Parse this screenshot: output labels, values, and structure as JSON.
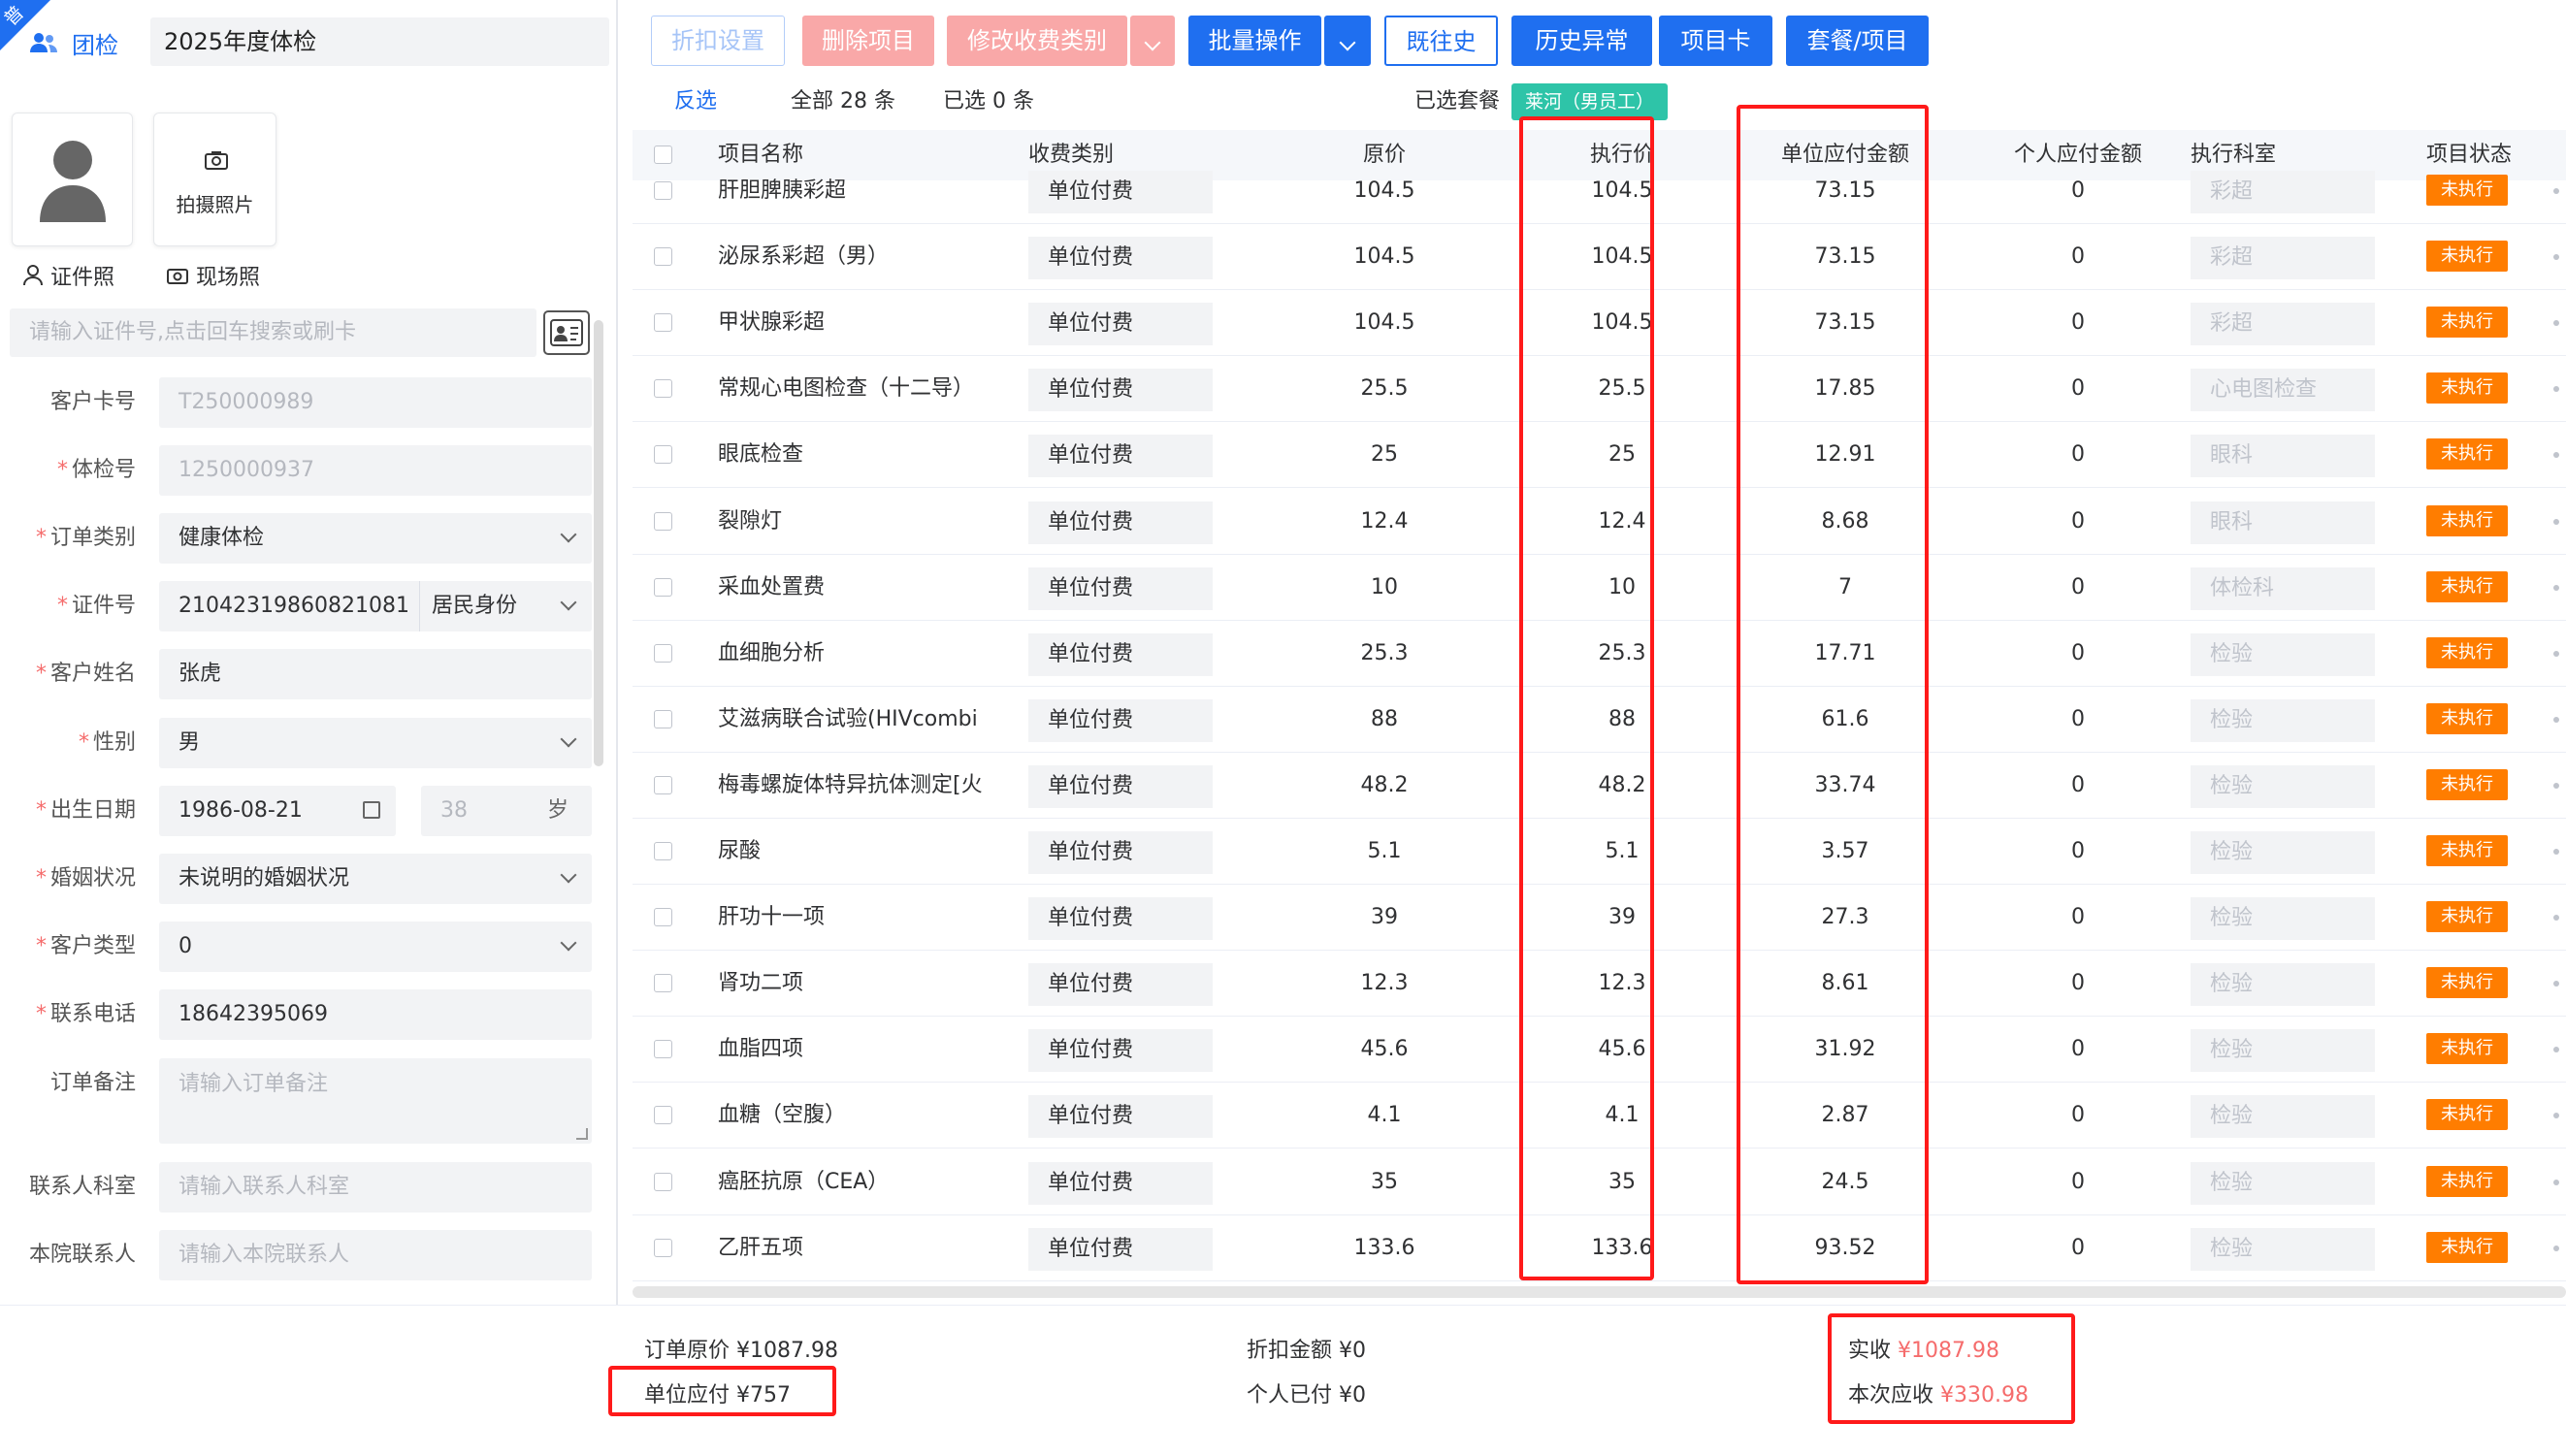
{
  "corner_badge": "普",
  "group_tab": "团检",
  "order_name": "2025年度体检",
  "photo": {
    "capture_label": "拍摄照片",
    "id_photo_label": "证件照",
    "live_photo_label": "现场照"
  },
  "search": {
    "placeholder": "请输入证件号,点击回车搜索或刷卡"
  },
  "form": [
    {
      "label": "客户卡号",
      "required": false,
      "value": "T250000989",
      "muted": true
    },
    {
      "label": "体检号",
      "required": true,
      "value": "1250000937",
      "muted": true
    },
    {
      "label": "订单类别",
      "required": true,
      "value": "健康体检",
      "select": true
    },
    {
      "label": "证件号",
      "required": true,
      "value": "21042319860821081",
      "id_type": "居民身份"
    },
    {
      "label": "客户姓名",
      "required": true,
      "value": "张虎"
    },
    {
      "label": "性别",
      "required": true,
      "value": "男",
      "select": true
    },
    {
      "label": "出生日期",
      "required": true,
      "value": "1986-08-21",
      "age": "38",
      "age_unit": "岁"
    },
    {
      "label": "婚姻状况",
      "required": true,
      "value": "未说明的婚姻状况",
      "select": true
    },
    {
      "label": "客户类型",
      "required": true,
      "value": "0",
      "select": true
    },
    {
      "label": "联系电话",
      "required": true,
      "value": "18642395069"
    },
    {
      "label": "订单备注",
      "required": false,
      "value": "请输入订单备注",
      "muted": true,
      "textarea": true
    },
    {
      "label": "联系人科室",
      "required": false,
      "value": "请输入联系人科室",
      "muted": true
    },
    {
      "label": "本院联系人",
      "required": false,
      "value": "请输入本院联系人",
      "muted": true
    }
  ],
  "toolbar": {
    "discount": "折扣设置",
    "delete": "删除项目",
    "modify_fee": "修改收费类别",
    "batch": "批量操作",
    "history": "既往史",
    "history_abnormal": "历史异常",
    "item_card": "项目卡",
    "package": "套餐/项目"
  },
  "stats": {
    "invert": "反选",
    "total": "全部 28 条",
    "selected": "已选 0 条",
    "package_label": "已选套餐",
    "package_tag": "莱河（男员工）"
  },
  "table": {
    "columns": [
      "项目名称",
      "收费类别",
      "原价",
      "执行价",
      "单位应付金额",
      "个人应付金额",
      "执行科室",
      "项目状态"
    ],
    "rows": [
      {
        "name": "肝胆脾胰彩超",
        "pay": "单位付费",
        "price": "104.5",
        "exec": "104.5",
        "unit": "73.15",
        "personal": "0",
        "dept": "彩超",
        "status": "未执行"
      },
      {
        "name": "泌尿系彩超（男）",
        "pay": "单位付费",
        "price": "104.5",
        "exec": "104.5",
        "unit": "73.15",
        "personal": "0",
        "dept": "彩超",
        "status": "未执行"
      },
      {
        "name": "甲状腺彩超",
        "pay": "单位付费",
        "price": "104.5",
        "exec": "104.5",
        "unit": "73.15",
        "personal": "0",
        "dept": "彩超",
        "status": "未执行"
      },
      {
        "name": "常规心电图检查（十二导）",
        "pay": "单位付费",
        "price": "25.5",
        "exec": "25.5",
        "unit": "17.85",
        "personal": "0",
        "dept": "心电图检查",
        "status": "未执行"
      },
      {
        "name": "眼底检查",
        "pay": "单位付费",
        "price": "25",
        "exec": "25",
        "unit": "12.91",
        "personal": "0",
        "dept": "眼科",
        "status": "未执行"
      },
      {
        "name": "裂隙灯",
        "pay": "单位付费",
        "price": "12.4",
        "exec": "12.4",
        "unit": "8.68",
        "personal": "0",
        "dept": "眼科",
        "status": "未执行"
      },
      {
        "name": "采血处置费",
        "pay": "单位付费",
        "price": "10",
        "exec": "10",
        "unit": "7",
        "personal": "0",
        "dept": "体检科",
        "status": "未执行"
      },
      {
        "name": "血细胞分析",
        "pay": "单位付费",
        "price": "25.3",
        "exec": "25.3",
        "unit": "17.71",
        "personal": "0",
        "dept": "检验",
        "status": "未执行"
      },
      {
        "name": "艾滋病联合试验(HIVcombi",
        "pay": "单位付费",
        "price": "88",
        "exec": "88",
        "unit": "61.6",
        "personal": "0",
        "dept": "检验",
        "status": "未执行"
      },
      {
        "name": "梅毒螺旋体特异抗体测定[火",
        "pay": "单位付费",
        "price": "48.2",
        "exec": "48.2",
        "unit": "33.74",
        "personal": "0",
        "dept": "检验",
        "status": "未执行"
      },
      {
        "name": "尿酸",
        "pay": "单位付费",
        "price": "5.1",
        "exec": "5.1",
        "unit": "3.57",
        "personal": "0",
        "dept": "检验",
        "status": "未执行"
      },
      {
        "name": "肝功十一项",
        "pay": "单位付费",
        "price": "39",
        "exec": "39",
        "unit": "27.3",
        "personal": "0",
        "dept": "检验",
        "status": "未执行"
      },
      {
        "name": "肾功二项",
        "pay": "单位付费",
        "price": "12.3",
        "exec": "12.3",
        "unit": "8.61",
        "personal": "0",
        "dept": "检验",
        "status": "未执行"
      },
      {
        "name": "血脂四项",
        "pay": "单位付费",
        "price": "45.6",
        "exec": "45.6",
        "unit": "31.92",
        "personal": "0",
        "dept": "检验",
        "status": "未执行"
      },
      {
        "name": "血糖（空腹）",
        "pay": "单位付费",
        "price": "4.1",
        "exec": "4.1",
        "unit": "2.87",
        "personal": "0",
        "dept": "检验",
        "status": "未执行"
      },
      {
        "name": "癌胚抗原（CEA）",
        "pay": "单位付费",
        "price": "35",
        "exec": "35",
        "unit": "24.5",
        "personal": "0",
        "dept": "检验",
        "status": "未执行"
      },
      {
        "name": "乙肝五项",
        "pay": "单位付费",
        "price": "133.6",
        "exec": "133.6",
        "unit": "93.52",
        "personal": "0",
        "dept": "检验",
        "status": "未执行"
      }
    ]
  },
  "footer": {
    "order_price": "订单原价 ¥1087.98",
    "unit_payable": "单位应付 ¥757",
    "discount_amount": "折扣金额 ¥0",
    "personal_paid": "个人已付 ¥0",
    "actual_label": "实收",
    "actual_value": "¥1087.98",
    "due_label": "本次应收",
    "due_value": "¥330.98"
  },
  "colors": {
    "primary": "#1f6ff0",
    "danger_light": "#f9a8a8",
    "status_orange": "#ff7d00",
    "tag_green": "#2ec4a8",
    "highlight_red": "#ff1a1a"
  }
}
